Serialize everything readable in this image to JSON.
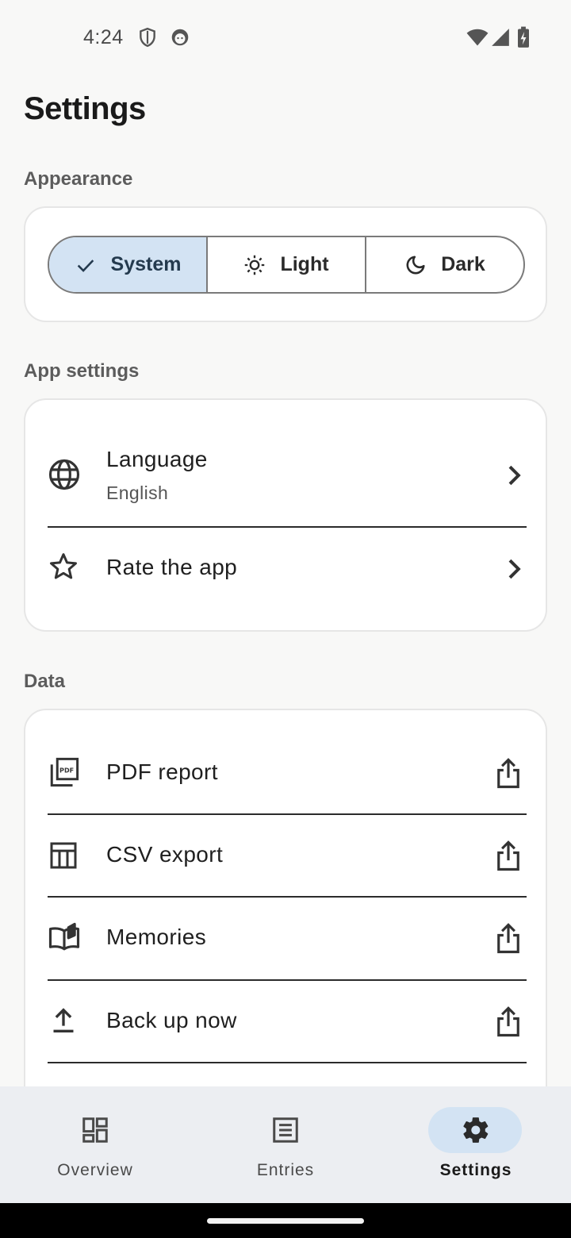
{
  "status_bar": {
    "time": "4:24",
    "left_icons": [
      "shield-icon",
      "face-icon"
    ],
    "right_icons": [
      "wifi-icon",
      "signal-icon",
      "battery-charging-icon"
    ]
  },
  "page": {
    "title": "Settings"
  },
  "appearance": {
    "header": "Appearance",
    "options": [
      {
        "label": "System",
        "icon": "check-icon",
        "selected": true
      },
      {
        "label": "Light",
        "icon": "sun-icon",
        "selected": false
      },
      {
        "label": "Dark",
        "icon": "moon-icon",
        "selected": false
      }
    ]
  },
  "app_settings": {
    "header": "App settings",
    "items": [
      {
        "title": "Language",
        "subtitle": "English",
        "icon": "globe-icon",
        "trailing": "chevron-right-icon"
      },
      {
        "title": "Rate the app",
        "icon": "star-icon",
        "trailing": "chevron-right-icon"
      }
    ]
  },
  "data_section": {
    "header": "Data",
    "items": [
      {
        "title": "PDF report",
        "icon": "pdf-icon",
        "trailing": "share-icon"
      },
      {
        "title": "CSV export",
        "icon": "table-icon",
        "trailing": "share-icon"
      },
      {
        "title": "Memories",
        "icon": "book-icon",
        "trailing": "share-icon"
      },
      {
        "title": "Back up now",
        "icon": "upload-icon",
        "trailing": "share-icon"
      }
    ]
  },
  "bottom_nav": {
    "items": [
      {
        "label": "Overview",
        "icon": "dashboard-icon",
        "active": false
      },
      {
        "label": "Entries",
        "icon": "list-icon",
        "active": false
      },
      {
        "label": "Settings",
        "icon": "gear-icon",
        "active": true
      }
    ]
  },
  "colors": {
    "background": "#f8f8f7",
    "accent_selected": "#d3e3f3",
    "nav_background": "#eceef2"
  }
}
